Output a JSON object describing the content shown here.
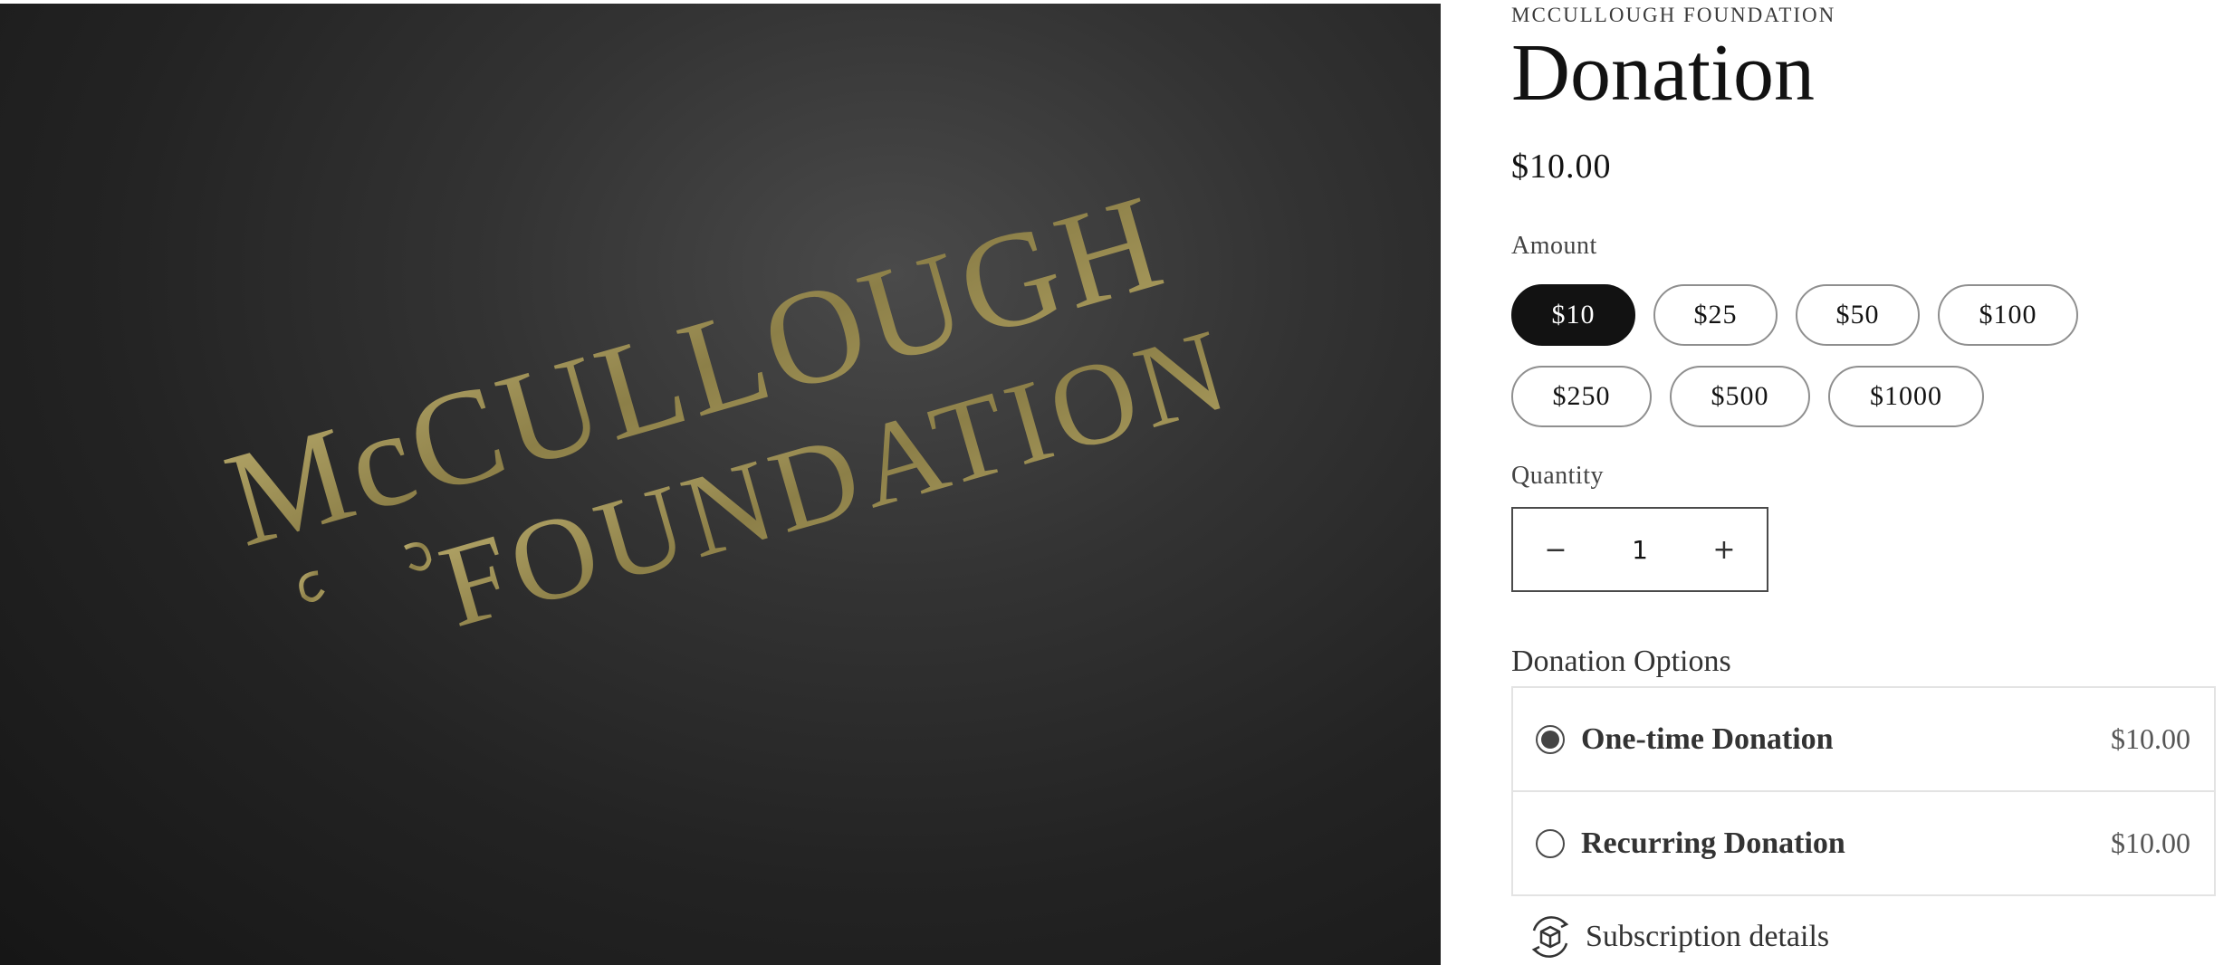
{
  "media": {
    "logo_line1": "McCULLOUGH",
    "logo_line2": "FOUNDATION",
    "logo_color": "#9c8f55"
  },
  "product": {
    "vendor": "MCCULLOUGH FOUNDATION",
    "title": "Donation",
    "price": "$10.00"
  },
  "amount": {
    "label": "Amount",
    "selected": "$10",
    "options": [
      "$10",
      "$25",
      "$50",
      "$100",
      "$250",
      "$500",
      "$1000"
    ]
  },
  "quantity": {
    "label": "Quantity",
    "value": "1",
    "decrease": "−",
    "increase": "+"
  },
  "donation_options": {
    "heading": "Donation Options",
    "items": [
      {
        "label": "One-time Donation",
        "price": "$10.00",
        "selected": true
      },
      {
        "label": "Recurring Donation",
        "price": "$10.00",
        "selected": false
      }
    ]
  },
  "subscription": {
    "label": "Subscription details",
    "icon": "subscription-box-icon"
  }
}
